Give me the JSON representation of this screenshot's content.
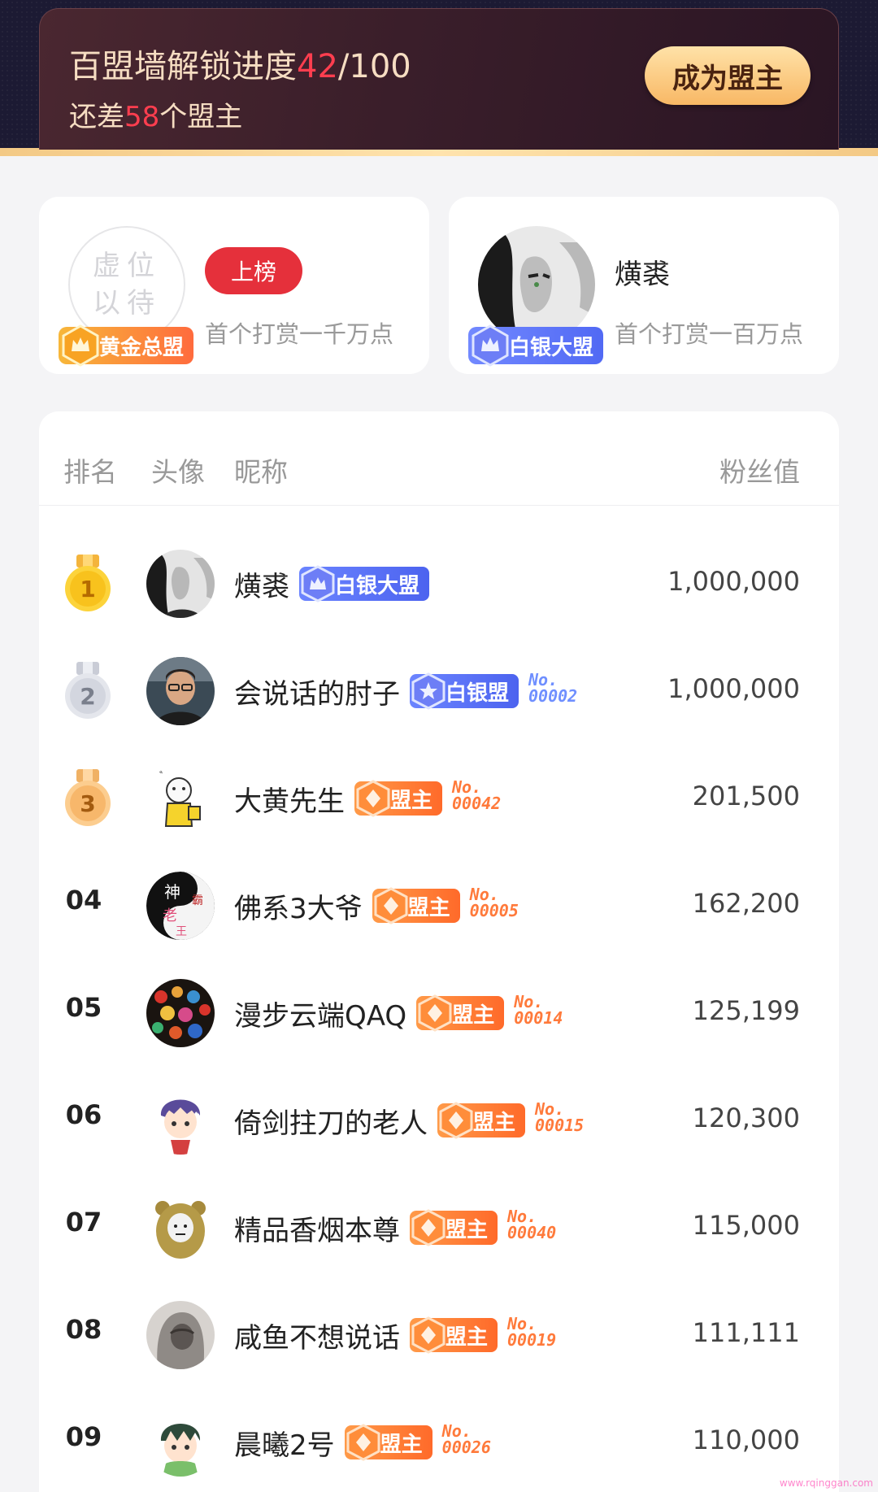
{
  "banner": {
    "title_prefix": "百盟墙解锁进度",
    "progress_current": "42",
    "progress_total": "/100",
    "sub_prefix": "还差",
    "remaining": "58",
    "sub_suffix": "个盟主",
    "become_button": "成为盟主",
    "progress_fraction": 0.42
  },
  "top_cards": {
    "gold": {
      "avatar_placeholder_line1": "虚位",
      "avatar_placeholder_line2": "以待",
      "badge": "黄金总盟",
      "onlist_button": "上榜",
      "description": "首个打赏一千万点"
    },
    "silver": {
      "name": "熿裘",
      "badge": "白银大盟",
      "description": "首个打赏一百万点"
    }
  },
  "list": {
    "headers": {
      "rank": "排名",
      "avatar": "头像",
      "nickname": "昵称",
      "fans": "粉丝值"
    },
    "rows": [
      {
        "rank": "1",
        "name": "熿裘",
        "tag": "白银大盟",
        "tag_color": "blue",
        "no_line1": "",
        "no_line2": "",
        "fans": "1,000,000"
      },
      {
        "rank": "2",
        "name": "会说话的肘子",
        "tag": "白银盟",
        "tag_color": "blue",
        "no_line1": "No.",
        "no_line2": "00002",
        "fans": "1,000,000"
      },
      {
        "rank": "3",
        "name": "大黄先生",
        "tag": "盟主",
        "tag_color": "orange",
        "no_line1": "No.",
        "no_line2": "00042",
        "fans": "201,500"
      },
      {
        "rank": "04",
        "name": "佛系3大爷",
        "tag": "盟主",
        "tag_color": "orange",
        "no_line1": "No.",
        "no_line2": "00005",
        "fans": "162,200"
      },
      {
        "rank": "05",
        "name": "漫步云端QAQ",
        "tag": "盟主",
        "tag_color": "orange",
        "no_line1": "No.",
        "no_line2": "00014",
        "fans": "125,199"
      },
      {
        "rank": "06",
        "name": "倚剑拄刀的老人",
        "tag": "盟主",
        "tag_color": "orange",
        "no_line1": "No.",
        "no_line2": "00015",
        "fans": "120,300"
      },
      {
        "rank": "07",
        "name": "精品香烟本尊",
        "tag": "盟主",
        "tag_color": "orange",
        "no_line1": "No.",
        "no_line2": "00040",
        "fans": "115,000"
      },
      {
        "rank": "08",
        "name": "咸鱼不想说话",
        "tag": "盟主",
        "tag_color": "orange",
        "no_line1": "No.",
        "no_line2": "00019",
        "fans": "111,111"
      },
      {
        "rank": "09",
        "name": "晨曦2号",
        "tag": "盟主",
        "tag_color": "orange",
        "no_line1": "No.",
        "no_line2": "00026",
        "fans": "110,000"
      }
    ]
  },
  "colors": {
    "accent_red": "#ff3e4f",
    "button_gold": "#f8b865",
    "badge_blue": "#5169f4",
    "badge_orange": "#ff6a2a"
  },
  "icons": {
    "gold_badge": "gold-crown-hex-icon",
    "silver_badge": "silver-crown-hex-icon",
    "leader_badge": "orange-hex-icon",
    "medal_gold": "gold-medal-icon",
    "medal_silver": "silver-medal-icon",
    "medal_bronze": "bronze-medal-icon"
  },
  "watermark": "www.rqinggan.com"
}
